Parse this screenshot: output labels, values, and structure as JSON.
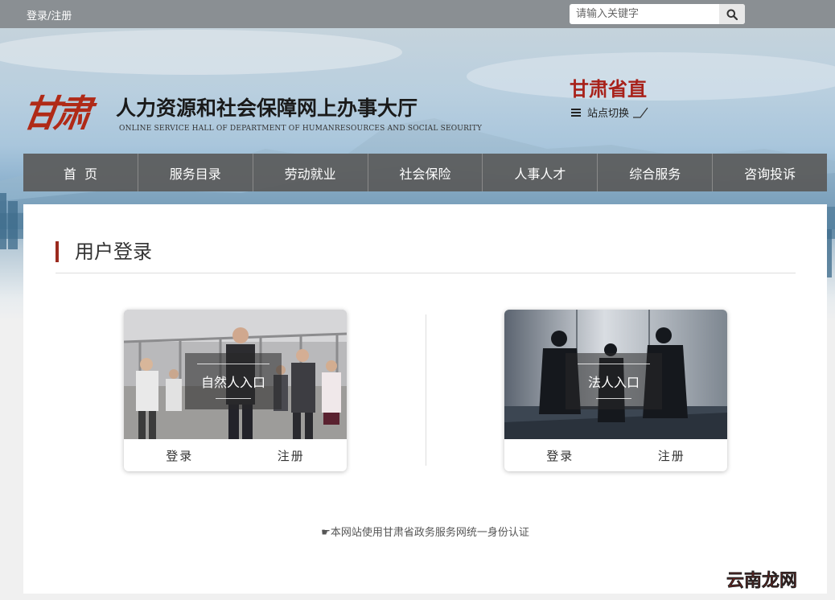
{
  "topbar": {
    "login_link": "登录/注册",
    "search": {
      "placeholder": "请输入关键字",
      "icon": "search-icon"
    }
  },
  "header": {
    "logo_text": "甘肃",
    "title": "人力资源和社会保障网上办事大厅",
    "subtitle": "ONLINE SERVICE HALL OF DEPARTMENT OF HUMANRESOURCES AND SOCIAL SEOURITY",
    "region": "甘肃省直",
    "switch_label": "站点切换",
    "switch_icon": "menu-icon"
  },
  "nav": {
    "items": [
      {
        "label": "首  页"
      },
      {
        "label": "服务目录"
      },
      {
        "label": "劳动就业"
      },
      {
        "label": "社会保险"
      },
      {
        "label": "人事人才"
      },
      {
        "label": "综合服务"
      },
      {
        "label": "咨询投诉"
      }
    ]
  },
  "main": {
    "section_title": "用户登录",
    "cards": [
      {
        "title": "自然人入口",
        "login": "登录",
        "register": "注册"
      },
      {
        "title": "法人入口",
        "login": "登录",
        "register": "注册"
      }
    ],
    "footer_note": "☛本网站使用甘肃省政务服务网统一身份认证"
  },
  "watermark": "云南龙网",
  "colors": {
    "accent_red": "#a8211a",
    "nav_bg": "#5a5a5a",
    "topbar_bg": "#8a8f93"
  }
}
